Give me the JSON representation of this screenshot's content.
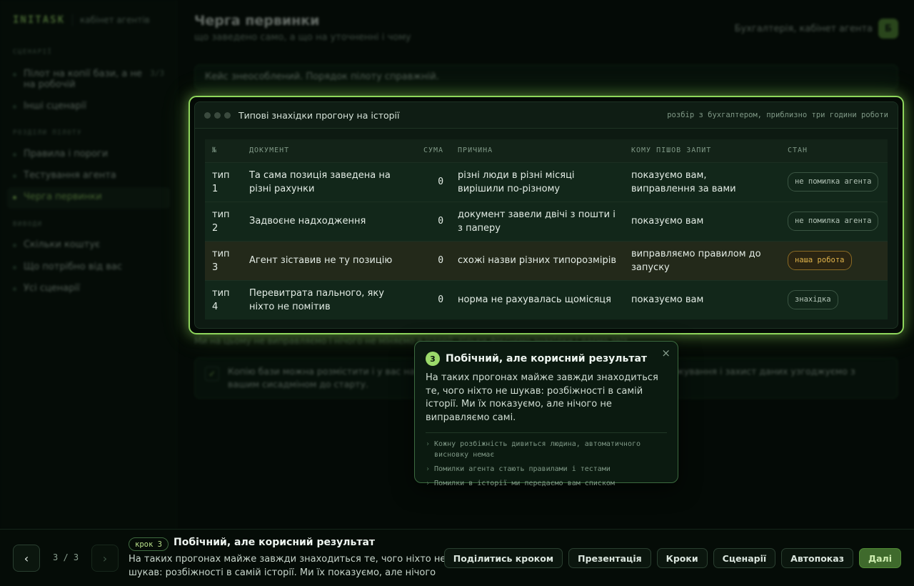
{
  "sidebar": {
    "brand": "INITASK",
    "brand_sub": "кабінет агентів",
    "sections": [
      "СЦЕНАРІЇ",
      "РОЗДІЛИ ПІЛОТУ",
      "ВИВОДИ"
    ],
    "scenarios": [
      {
        "label": "Пілот на копії бази, а не на робочій",
        "count": "3/3"
      },
      {
        "label": "Інші сценарії",
        "count": ""
      }
    ],
    "pilot": [
      {
        "label": "Правила і пороги"
      },
      {
        "label": "Тестування агента"
      },
      {
        "label": "Черга первинки"
      }
    ],
    "conclusions": [
      {
        "label": "Скільки коштує"
      },
      {
        "label": "Що потрібно від вас"
      },
      {
        "label": "Усі сценарії"
      }
    ]
  },
  "header": {
    "title": "Черга первинки",
    "subtitle": "що заведено само, а що на уточненні і чому",
    "account": "Бухгалтерія, кабінет агента",
    "avatar": "Б"
  },
  "notice": "Кейс знеособлений. Порядок пілоту справжній.",
  "footnote": "Ми на цьому не виправляємо і нічого не міняємо в історії, тільки фіксуємо знахідки і даємо звіт.",
  "callout": "Копію бази можна розмістити і у вас на сервері, і в ізольованому хмарному середовищі. Розмежування і захист даних узгоджуємо з вашим сисадміном до старту.",
  "window": {
    "title": "Типові знахідки прогону на історії",
    "meta": "розбір з бухгалтером, приблизно три години роботи",
    "columns": [
      "№",
      "ДОКУМЕНТ",
      "СУМА",
      "ПРИЧИНА",
      "КОМУ ПІШОВ ЗАПИТ",
      "СТАН"
    ],
    "rows": [
      {
        "n": "тип 1",
        "doc": "Та сама позиція заведена на різні рахунки",
        "sum": "0",
        "reason": "різні люди в різні місяці вирішили по-різному",
        "to": "показуємо вам, виправлення за вами",
        "state": "не помилка агента",
        "warn": false
      },
      {
        "n": "тип 2",
        "doc": "Задвоєне надходження",
        "sum": "0",
        "reason": "документ завели двічі з пошти і з паперу",
        "to": "показуємо вам",
        "state": "не помилка агента",
        "warn": false
      },
      {
        "n": "тип 3",
        "doc": "Агент зіставив не ту позицію",
        "sum": "0",
        "reason": "схожі назви різних типорозмірів",
        "to": "виправляємо правилом до запуску",
        "state": "наша робота",
        "warn": true
      },
      {
        "n": "тип 4",
        "doc": "Перевитрата пального, яку ніхто не помітив",
        "sum": "0",
        "reason": "норма не рахувалась щомісяця",
        "to": "показуємо вам",
        "state": "знахідка",
        "warn": false
      }
    ]
  },
  "popover": {
    "num": "3",
    "title": "Побічний, але корисний результат",
    "text": "На таких прогонах майже завжди знаходиться те, чого ніхто не шукав: розбіжності в самій історії. Ми їх показуємо, але нічого не виправляємо самі.",
    "close": "×",
    "points": [
      "Кожну розбіжність дивиться людина, автоматичного висновку немає",
      "Помилки агента стають правилами і тестами",
      "Помилки в історії ми передаємо вам списком"
    ]
  },
  "bottom": {
    "prev": "‹",
    "next": "›",
    "counter": "3 / 3",
    "step_label": "крок 3",
    "step_title": "Побічний, але корисний результат",
    "step_desc": "На таких прогонах майже завжди знаходиться те, чого ніхто не шукав: розбіжності в самій історії. Ми їх показуємо, але нічого не...",
    "actions": {
      "share": "Поділитись кроком",
      "presentation": "Презентація",
      "steps": "Кроки",
      "scenarios": "Сценарії",
      "autoplay": "Автопоказ",
      "next": "Далі"
    }
  },
  "colors": {
    "accent": "#9bd96a",
    "warn": "#e0b34a",
    "background": "#040a06"
  }
}
